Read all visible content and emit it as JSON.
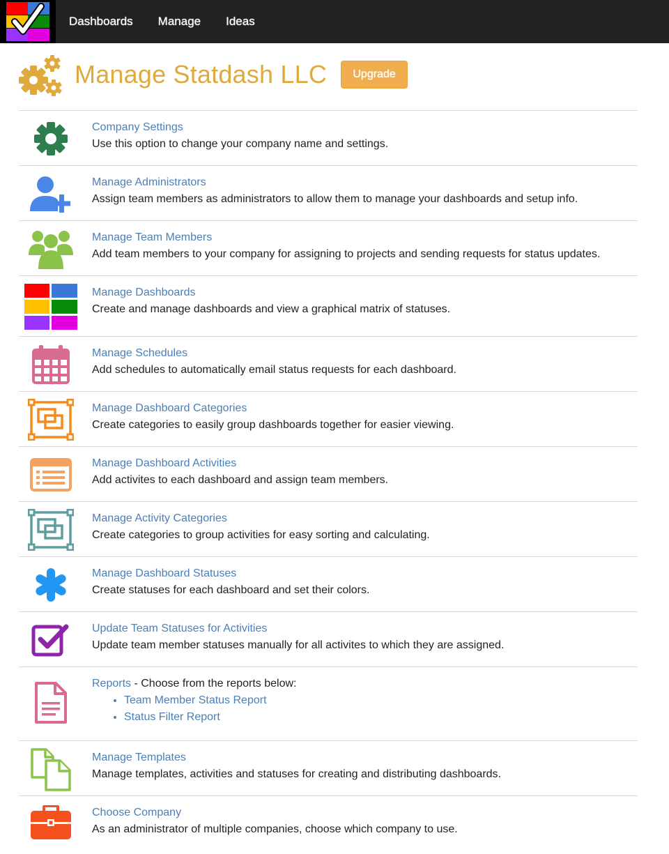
{
  "nav": {
    "items": [
      "Dashboards",
      "Manage",
      "Ideas"
    ]
  },
  "header": {
    "title": "Manage Statdash LLC",
    "upgrade_label": "Upgrade"
  },
  "colors": {
    "title": "#e0a93c",
    "link": "#4a7fb8",
    "upgrade": "#f0ad4e"
  },
  "items": [
    {
      "title": "Company Settings",
      "desc": "Use this option to change your company name and settings.",
      "icon": "gear-icon",
      "color": "#2e7d4f"
    },
    {
      "title": "Manage Administrators",
      "desc": "Assign team members as administrators to allow them to manage your dashboards and setup info.",
      "icon": "add-user-icon",
      "color": "#4a86e8"
    },
    {
      "title": "Manage Team Members",
      "desc": "Add team members to your company for assigning to projects and sending requests for status updates.",
      "icon": "team-icon",
      "color": "#8bc34a"
    },
    {
      "title": "Manage Dashboards",
      "desc": "Create and manage dashboards and view a graphical matrix of statuses.",
      "icon": "color-grid-icon",
      "color": "#ff0000"
    },
    {
      "title": "Manage Schedules",
      "desc": "Add schedules to automatically email status requests for each dashboard.",
      "icon": "calendar-icon",
      "color": "#d96b8e"
    },
    {
      "title": "Manage Dashboard Categories",
      "desc": "Create categories to easily group dashboards together for easier viewing.",
      "icon": "group-objects-icon",
      "color": "#f48b1f"
    },
    {
      "title": "Manage Dashboard Activities",
      "desc": "Add activites to each dashboard and assign team members.",
      "icon": "list-icon",
      "color": "#f4a261"
    },
    {
      "title": "Manage Activity Categories",
      "desc": "Create categories to group activities for easy sorting and calculating.",
      "icon": "group-objects-icon",
      "color": "#5f9ea0"
    },
    {
      "title": "Manage Dashboard Statuses",
      "desc": "Create statuses for each dashboard and set their colors.",
      "icon": "asterisk-icon",
      "color": "#2196f3"
    },
    {
      "title": "Update Team Statuses for Activities",
      "desc": "Update team member statuses manually for all activites to which they are assigned.",
      "icon": "checkbox-icon",
      "color": "#8e24aa"
    }
  ],
  "reports": {
    "title": "Reports",
    "suffix": " - Choose from the reports below:",
    "links": [
      "Team Member Status Report",
      "Status Filter Report"
    ],
    "icon": "document-icon",
    "color": "#d96b8e"
  },
  "tail_items": [
    {
      "title": "Manage Templates",
      "desc": "Manage templates, activities and statuses for creating and distributing dashboards.",
      "icon": "copy-icon",
      "color": "#8bc34a"
    },
    {
      "title": "Choose Company",
      "desc": "As an administrator of multiple companies, choose which company to use.",
      "icon": "briefcase-icon",
      "color": "#f4511e"
    }
  ]
}
